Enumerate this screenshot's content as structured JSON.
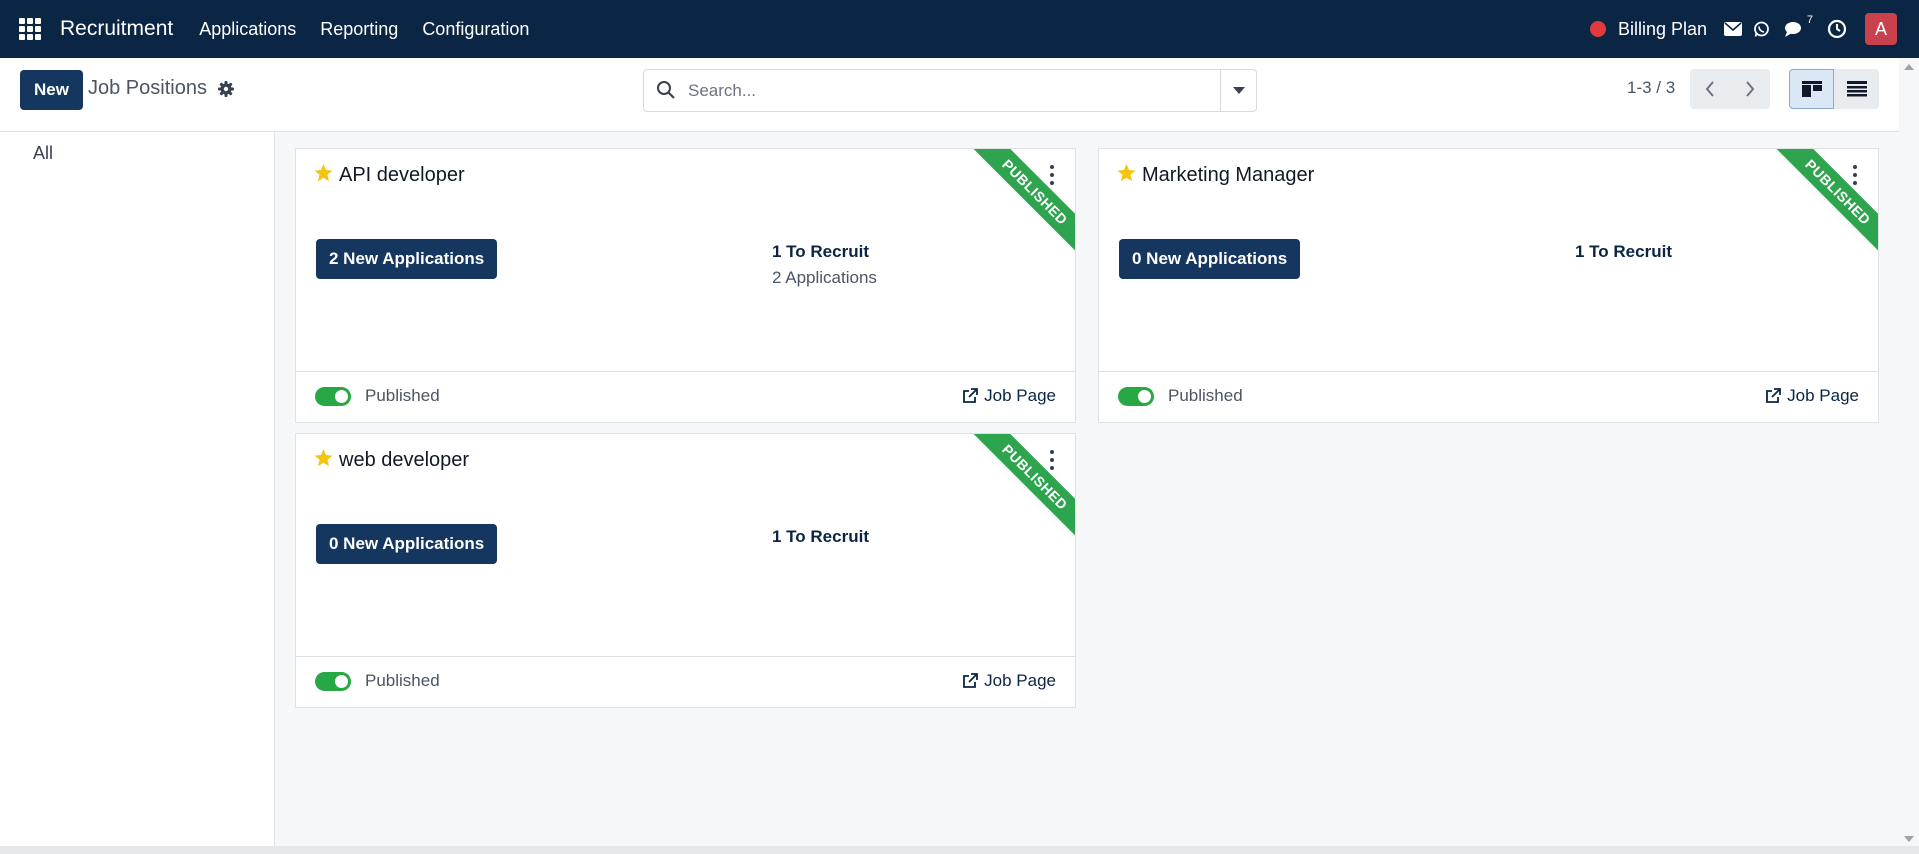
{
  "navbar": {
    "app_name": "Recruitment",
    "menu": [
      "Applications",
      "Reporting",
      "Configuration"
    ],
    "billing_label": "Billing Plan",
    "chat_badge": "7",
    "avatar_initial": "A",
    "colors": {
      "navbar_bg": "#0b2545",
      "status_dot": "#e03a3e",
      "avatar_bg": "#c9414c"
    }
  },
  "control_panel": {
    "new_label": "New",
    "title": "Job Positions",
    "search_placeholder": "Search...",
    "pager": "1-3 / 3"
  },
  "side_panel": {
    "filters": [
      "All"
    ]
  },
  "cards": [
    {
      "title": "API developer",
      "new_applications": "2 New Applications",
      "to_recruit": "1 To Recruit",
      "applications": "2 Applications",
      "ribbon": "PUBLISHED",
      "published_label": "Published",
      "job_page_label": "Job Page"
    },
    {
      "title": "Marketing Manager",
      "new_applications": "0 New Applications",
      "to_recruit": "1 To Recruit",
      "ribbon": "PUBLISHED",
      "published_label": "Published",
      "job_page_label": "Job Page"
    },
    {
      "title": "web developer",
      "new_applications": "0 New Applications",
      "to_recruit": "1 To Recruit",
      "ribbon": "PUBLISHED",
      "published_label": "Published",
      "job_page_label": "Job Page"
    }
  ],
  "icons": {
    "apps": "apps-grid-icon",
    "mail": "envelope-icon",
    "whatsapp": "whatsapp-icon",
    "chat": "chat-icon",
    "activity": "clock-icon",
    "settings": "gear-icon",
    "search": "search-icon",
    "dropdown": "caret-down-icon",
    "favorite": "star-icon",
    "menu": "kebab-menu-icon",
    "external": "external-link-icon"
  },
  "accent_colors": {
    "primary_button": "#15365f",
    "published_green": "#2ea44f",
    "star": "#f3c511"
  }
}
